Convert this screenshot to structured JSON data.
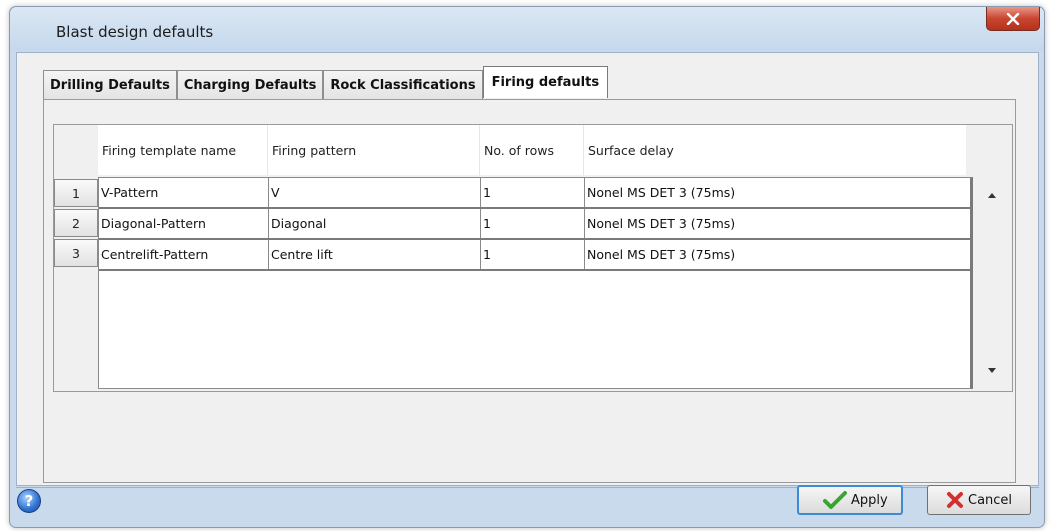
{
  "window": {
    "title": "Blast design defaults",
    "close_label": "x"
  },
  "tabs": [
    {
      "label": "Drilling Defaults",
      "active": false
    },
    {
      "label": "Charging Defaults",
      "active": false
    },
    {
      "label": "Rock Classifications",
      "active": false
    },
    {
      "label": "Firing defaults",
      "active": true
    }
  ],
  "table": {
    "headers": [
      "Firing template name",
      "Firing pattern",
      "No. of rows",
      "Surface delay"
    ],
    "rows": [
      {
        "num": "1",
        "cells": [
          "V-Pattern",
          "V",
          "1",
          "Nonel MS DET 3 (75ms)"
        ]
      },
      {
        "num": "2",
        "cells": [
          "Diagonal-Pattern",
          "Diagonal",
          "1",
          "Nonel MS DET 3 (75ms)"
        ]
      },
      {
        "num": "3",
        "cells": [
          "Centrelift-Pattern",
          "Centre lift",
          "1",
          "Nonel MS DET 3 (75ms)"
        ]
      }
    ]
  },
  "footer": {
    "help_label": "?",
    "apply_label": "Apply",
    "cancel_label": "Cancel"
  },
  "colors": {
    "window_frame": "#c9daed",
    "close_button": "#c9452f",
    "apply_border": "#3c8bd6",
    "apply_check": "#39a531",
    "cancel_x": "#d32f2f"
  },
  "icons": {
    "close": "close-icon",
    "help": "help-icon",
    "apply": "checkmark-icon",
    "cancel": "x-icon",
    "scroll_up": "scroll-up-arrow-icon",
    "scroll_down": "scroll-down-arrow-icon"
  }
}
